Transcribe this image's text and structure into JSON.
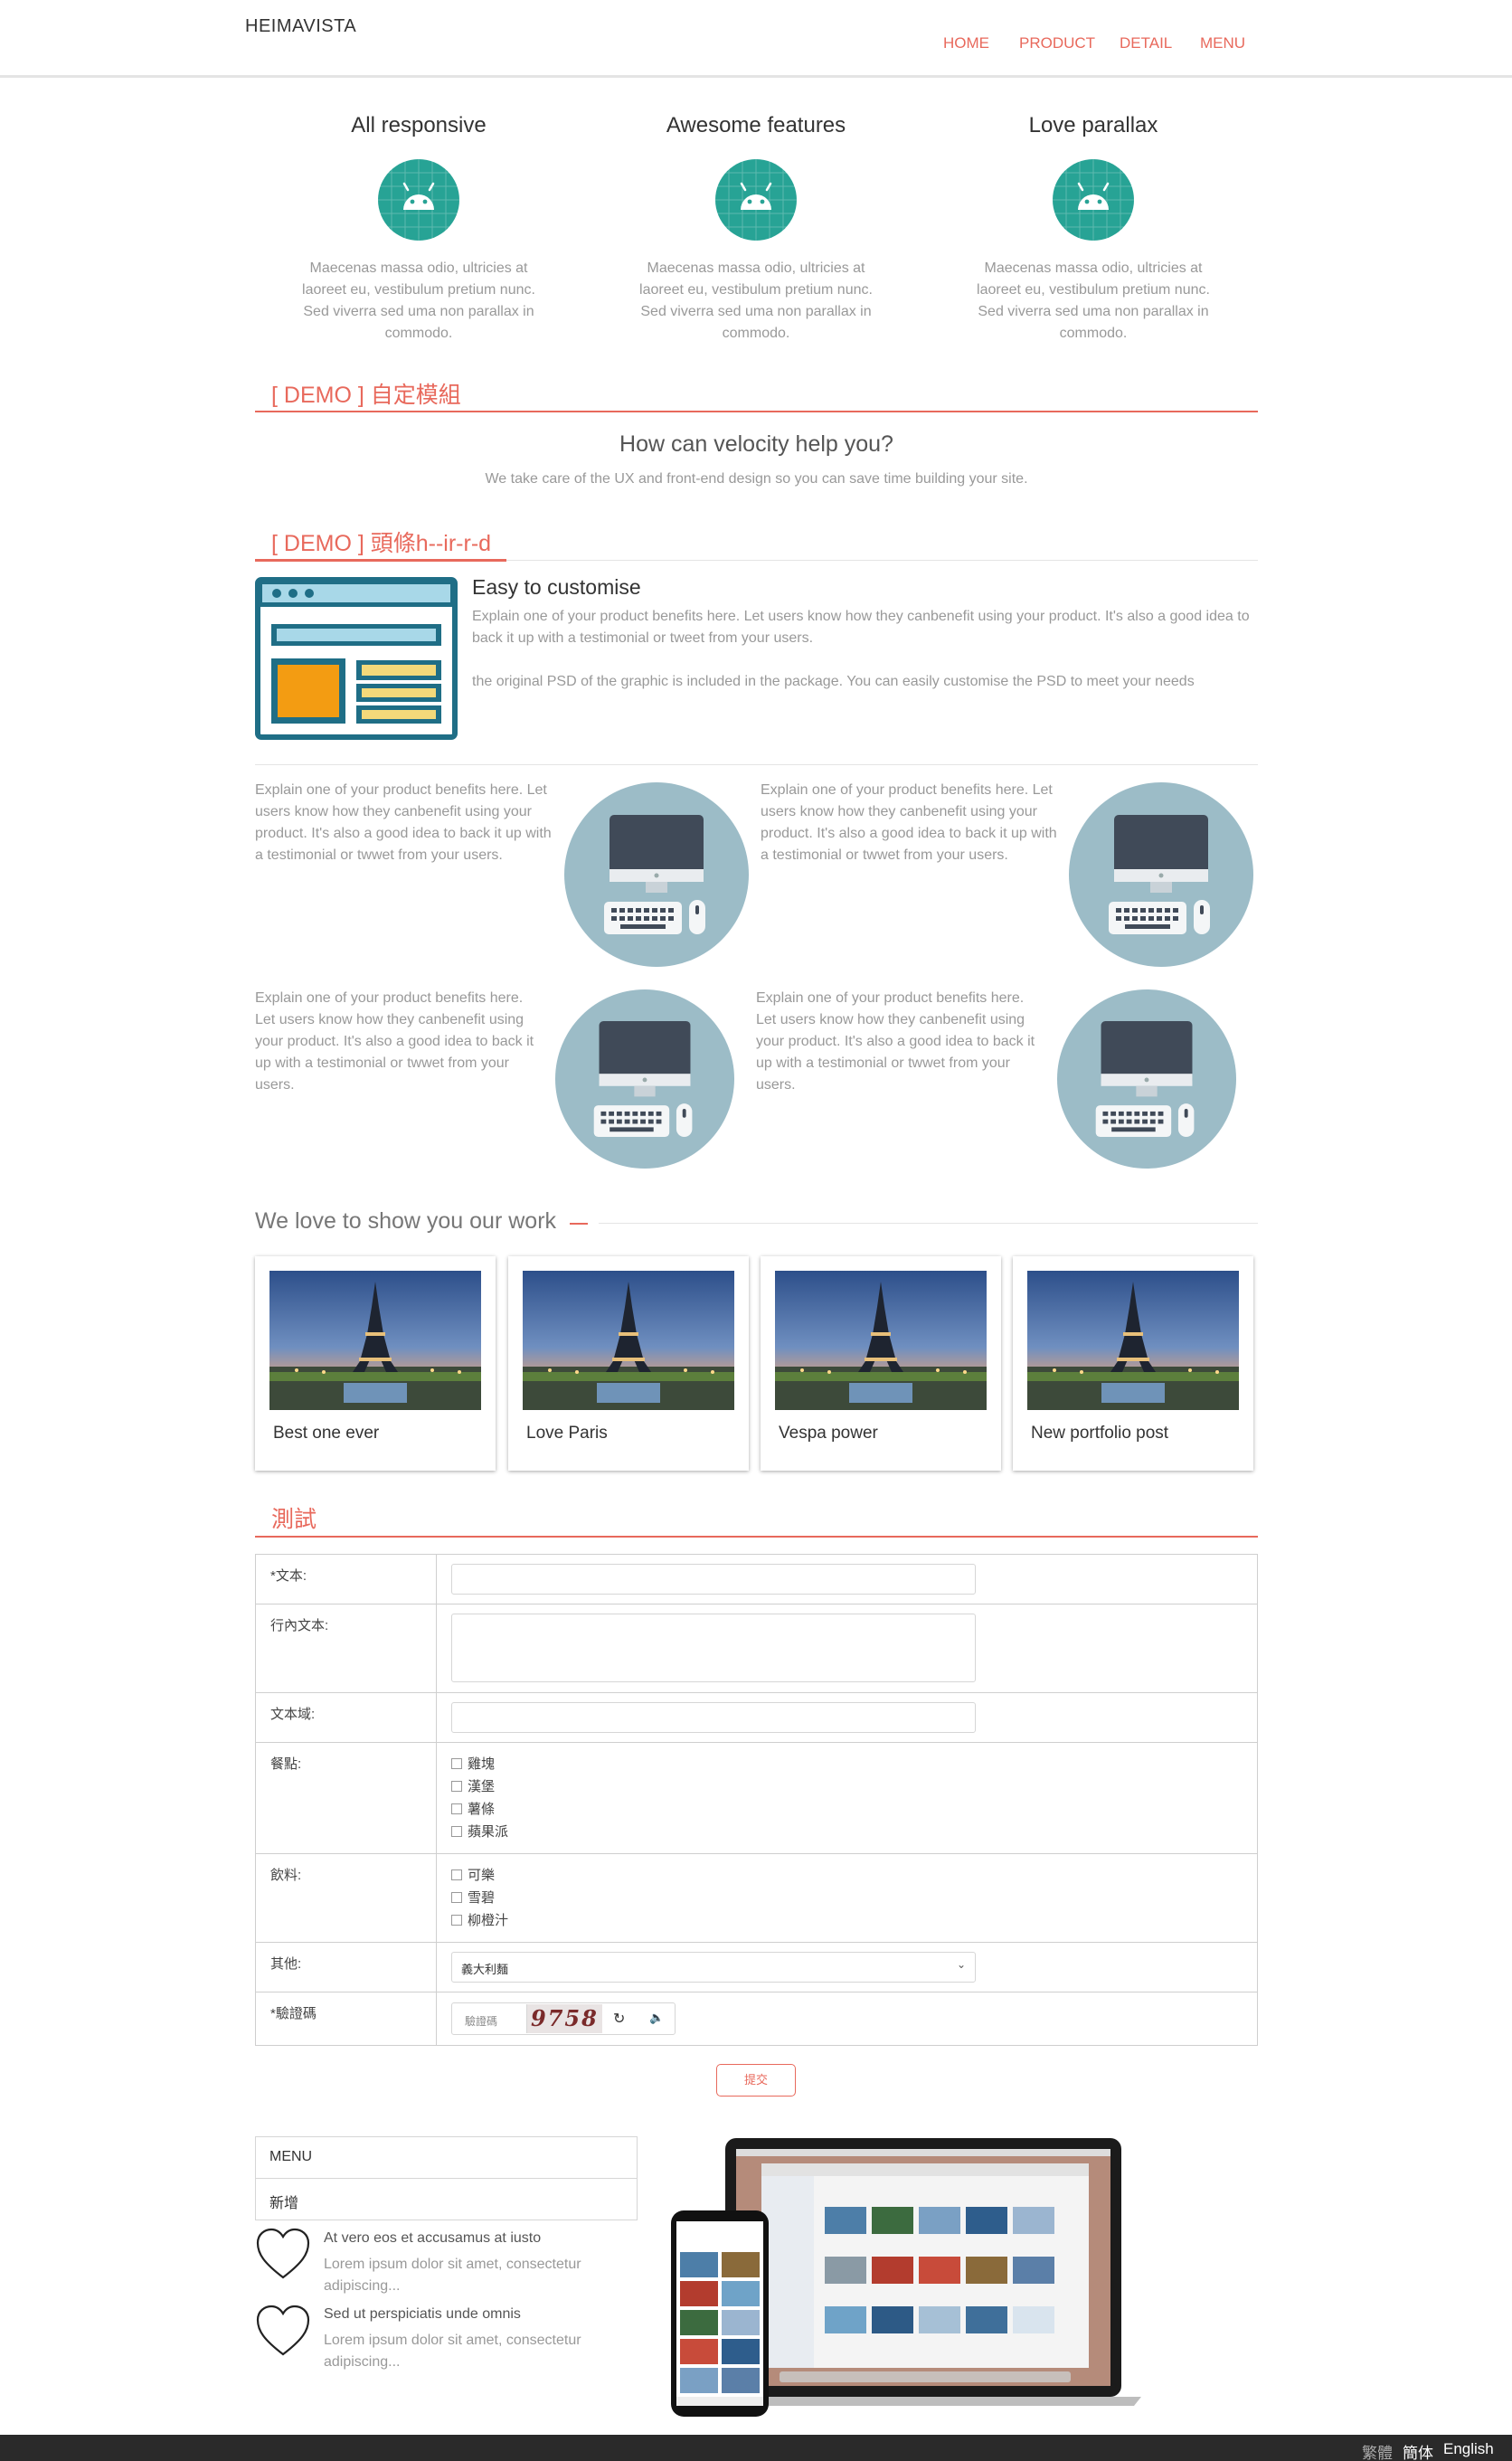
{
  "header": {
    "logo": "HEIMAVISTA",
    "nav": [
      "HOME",
      "PRODUCT",
      "DETAIL",
      "MENU"
    ]
  },
  "features": [
    {
      "title": "All responsive",
      "icon": "android-icon",
      "text": "Maecenas massa odio, ultricies at laoreet eu, vestibulum pretium nunc. Sed viverra sed uma non parallax in commodo."
    },
    {
      "title": "Awesome features",
      "icon": "android-icon",
      "text": "Maecenas massa odio, ultricies at laoreet eu, vestibulum pretium nunc. Sed viverra sed uma non parallax in commodo."
    },
    {
      "title": "Love parallax",
      "icon": "android-icon",
      "text": "Maecenas massa odio, ultricies at laoreet eu, vestibulum pretium nunc. Sed viverra sed uma non parallax in commodo."
    }
  ],
  "demo1": {
    "title": "[ DEMO ] 自定模組",
    "heading": "How can velocity help you?",
    "sub": "We take care of the UX and front-end design so you can save time building your site."
  },
  "demo2": {
    "title": "[ DEMO ] 頭條h--ir-r-d",
    "heading": "Easy to customise",
    "p1": "Explain one of your product benefits here. Let users know how they canbenefit using your product. It's also a good idea to back it up with a testimonial or tweet from your users.",
    "p2": "the original PSD of the graphic is included in the package. You can easily customise the PSD to meet your needs"
  },
  "benefits": [
    "Explain one of your product benefits here. Let users know how they canbenefit using your product. It's also a good idea to back it up with a testimonial or twwet from your users.",
    "Explain one of your product benefits here. Let users know how they canbenefit using your product. It's also a good idea to back it up with a testimonial or twwet from your users.",
    "Explain one of your product benefits here. Let users know how they canbenefit using your product. It's also a good idea to back it up with a testimonial or twwet from your users.",
    "Explain one of your product benefits here. Let users know how they canbenefit using your product. It's also a good idea to back it up with a testimonial or twwet from your users."
  ],
  "work": {
    "title": "We love to show you our work",
    "cards": [
      "Best one ever",
      "Love Paris",
      "Vespa power",
      "New portfolio post"
    ]
  },
  "form": {
    "title": "測試",
    "text_label": "*文本:",
    "inline_label": "行內文本:",
    "area_label": "文本域:",
    "meal_label": "餐點:",
    "meals": [
      "雞塊",
      "漢堡",
      "薯條",
      "蘋果派"
    ],
    "drink_label": "飲料:",
    "drinks": [
      "可樂",
      "雪碧",
      "柳橙汁"
    ],
    "other_label": "其他:",
    "other_selected": "義大利麵",
    "captcha_label": "*驗證碼",
    "captcha_placeholder": "驗證碼",
    "captcha_code": "9758",
    "submit": "提交"
  },
  "menu": {
    "header": "MENU",
    "item": "新增"
  },
  "list": [
    {
      "title": "At vero eos et accusamus at iusto",
      "sub": "Lorem ipsum dolor sit amet, consectetur adipiscing..."
    },
    {
      "title": "Sed ut perspiciatis unde omnis",
      "sub": "Lorem ipsum dolor sit amet, consectetur adipiscing..."
    }
  ],
  "footer": {
    "langs": [
      "繁體",
      "簡体",
      "English"
    ]
  },
  "colors": {
    "accent": "#e8695c",
    "teal": "#27a395",
    "circle": "#9cbcc7"
  }
}
